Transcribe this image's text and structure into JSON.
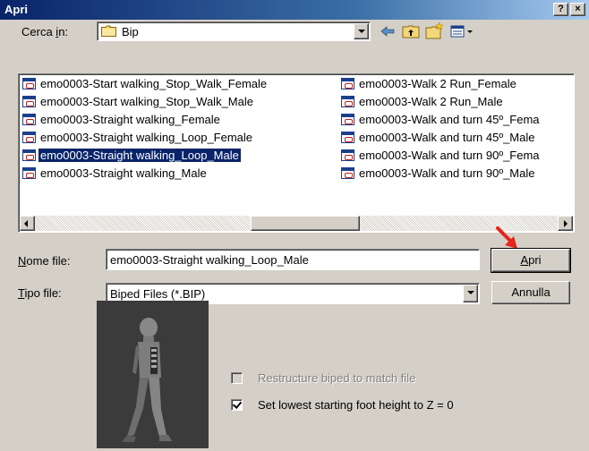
{
  "window": {
    "title": "Apri",
    "help_label": "?",
    "close_label": "×"
  },
  "lookin": {
    "label_pre": "Cerca ",
    "label_u": "i",
    "label_post": "n:",
    "value": "Bip"
  },
  "files_left": [
    "emo0003-Start walking_Stop_Walk_Female",
    "emo0003-Start walking_Stop_Walk_Male",
    "emo0003-Straight walking_Female",
    "emo0003-Straight walking_Loop_Female",
    "emo0003-Straight walking_Loop_Male",
    "emo0003-Straight walking_Male"
  ],
  "files_right": [
    "emo0003-Walk 2 Run_Female",
    "emo0003-Walk 2 Run_Male",
    "emo0003-Walk and turn 45º_Fema",
    "emo0003-Walk and turn 45º_Male",
    "emo0003-Walk and turn 90º_Fema",
    "emo0003-Walk and turn 90º_Male"
  ],
  "filename": {
    "label_u": "N",
    "label_post": "ome file:",
    "value": "emo0003-Straight walking_Loop_Male"
  },
  "filetype": {
    "label_u": "T",
    "label_post": "ipo file:",
    "value": "Biped Files (*.BIP)"
  },
  "buttons": {
    "open_u": "A",
    "open_post": "pri",
    "cancel": "Annulla"
  },
  "options": {
    "restructure": "Restructure biped to match file",
    "restructure_checked": false,
    "lowest_foot": "Set lowest starting foot height to Z = 0",
    "lowest_foot_checked": true
  },
  "colors": {
    "titlebar": "#0a246a",
    "selection": "#0a246a",
    "face": "#d4d0c8",
    "arrow": "#e8231a"
  }
}
